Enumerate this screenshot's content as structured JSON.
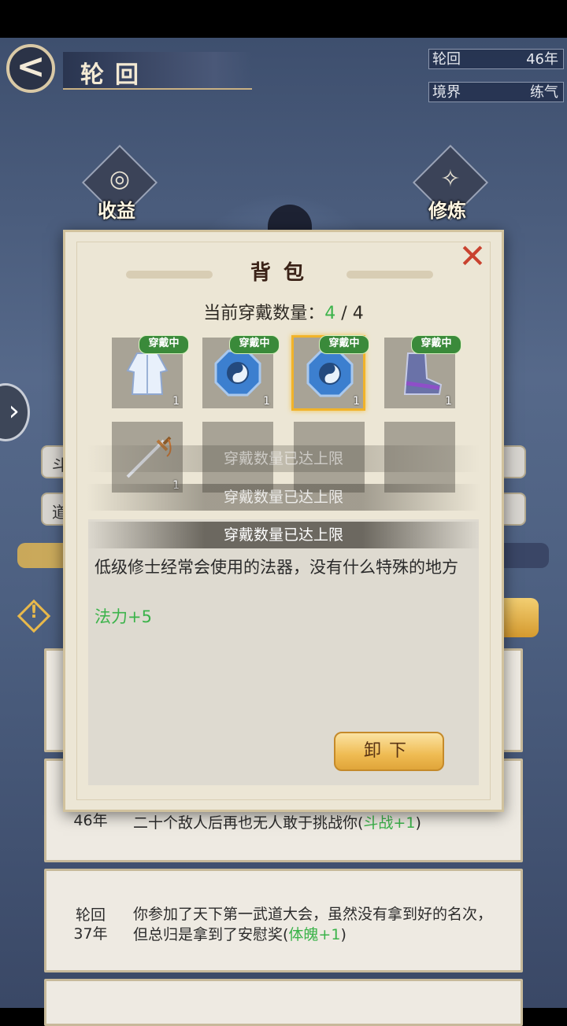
{
  "header": {
    "title": "轮回",
    "back_label": "<"
  },
  "status": {
    "cycle_label": "轮回",
    "cycle_value": "46年",
    "realm_label": "境界",
    "realm_value": "练气"
  },
  "emblems": {
    "left_label": "收益",
    "right_label": "修炼",
    "left_icon": "income-icon",
    "right_icon": "cultivate-icon"
  },
  "background": {
    "pill_1": "斗",
    "pill_2": "道",
    "cards": [
      {
        "year": "46年",
        "text": "二十个敌人后再也无人敢于挑战你(",
        "bonus": "斗战+1",
        "tail": ")"
      },
      {
        "year_line1": "轮回",
        "year_line2": "37年",
        "line1": "你参加了天下第一武道大会，虽然没有拿到好的名次，",
        "line2": "但总归是拿到了安慰奖(",
        "bonus": "体魄+1",
        "tail": ")"
      }
    ]
  },
  "modal": {
    "title": "背包",
    "count_label": "当前穿戴数量：",
    "count_current": "4",
    "count_sep": " / ",
    "count_max": "4",
    "badge": "穿戴中",
    "slots": [
      {
        "name": "robe",
        "qty": "1",
        "equipped": true
      },
      {
        "name": "bagua-mirror",
        "qty": "1",
        "equipped": true
      },
      {
        "name": "bagua-mirror",
        "qty": "1",
        "equipped": true,
        "selected": true
      },
      {
        "name": "boots",
        "qty": "1",
        "equipped": true
      },
      {
        "name": "sword",
        "qty": "1",
        "equipped": false
      }
    ],
    "toast": "穿戴数量已达上限",
    "toast_faint_top": "穿戴数量已达上限",
    "description": "低级修士经常会使用的法器，没有什么特殊的地方",
    "bonus": "法力+5",
    "unequip_label": "卸下"
  },
  "colors": {
    "accent_green": "#3bb34a",
    "gold_button": "#efbb52",
    "close_red": "#c9422f"
  }
}
